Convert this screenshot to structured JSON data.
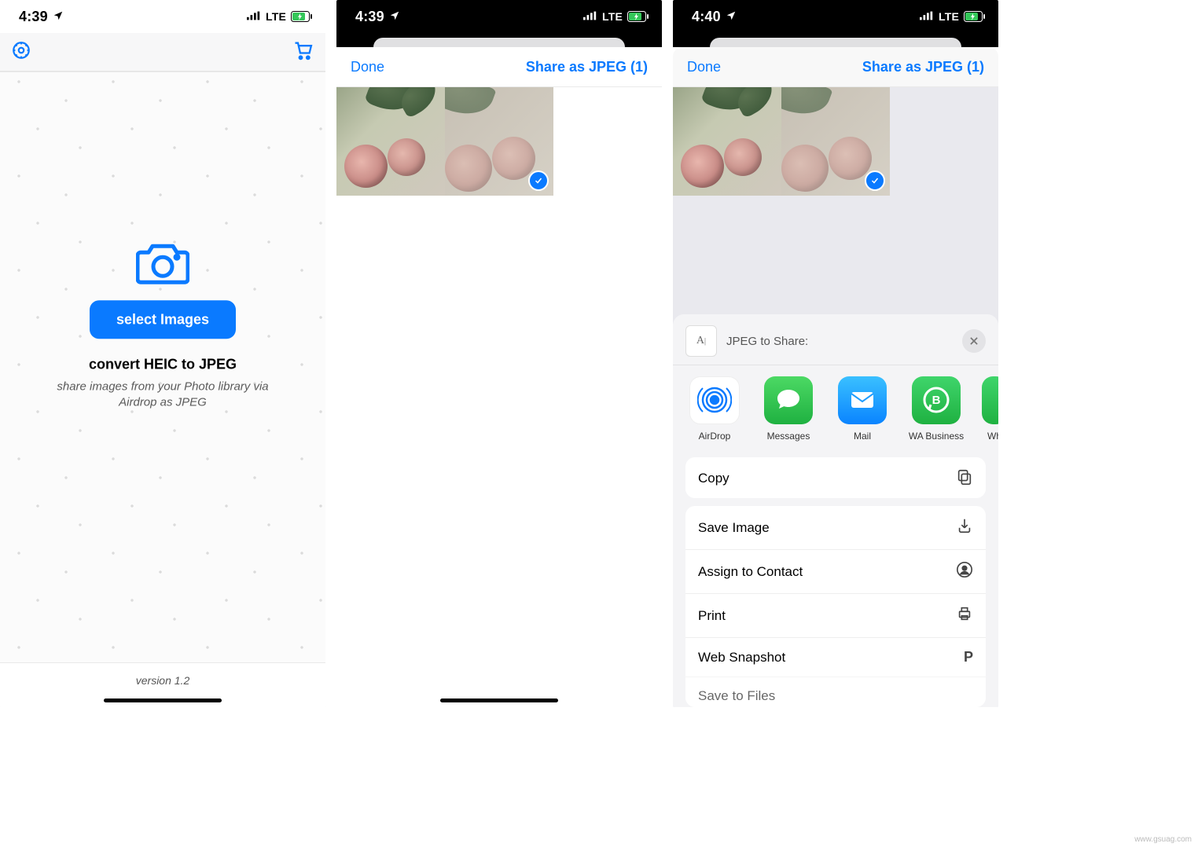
{
  "watermark": "www.gsuag.com",
  "screens": {
    "s1": {
      "status": {
        "time": "4:39",
        "network": "LTE"
      },
      "select_button": "select Images",
      "heading": "convert HEIC to JPEG",
      "subtext": "share images from your Photo library via Airdrop as JPEG",
      "version": "version 1.2"
    },
    "s2": {
      "status": {
        "time": "4:39",
        "network": "LTE"
      },
      "nav": {
        "done": "Done",
        "share": "Share as JPEG (1)"
      }
    },
    "s3": {
      "status": {
        "time": "4:40",
        "network": "LTE"
      },
      "nav": {
        "done": "Done",
        "share": "Share as JPEG (1)"
      },
      "sheet": {
        "title": "JPEG to Share:",
        "apps": [
          {
            "label": "AirDrop"
          },
          {
            "label": "Messages"
          },
          {
            "label": "Mail"
          },
          {
            "label": "WA Business"
          },
          {
            "label": "Wh"
          }
        ],
        "actions_a": [
          {
            "label": "Copy"
          }
        ],
        "actions_b": [
          {
            "label": "Save Image"
          },
          {
            "label": "Assign to Contact"
          },
          {
            "label": "Print"
          },
          {
            "label": "Web Snapshot"
          },
          {
            "label": "Save to Files"
          }
        ]
      }
    }
  }
}
